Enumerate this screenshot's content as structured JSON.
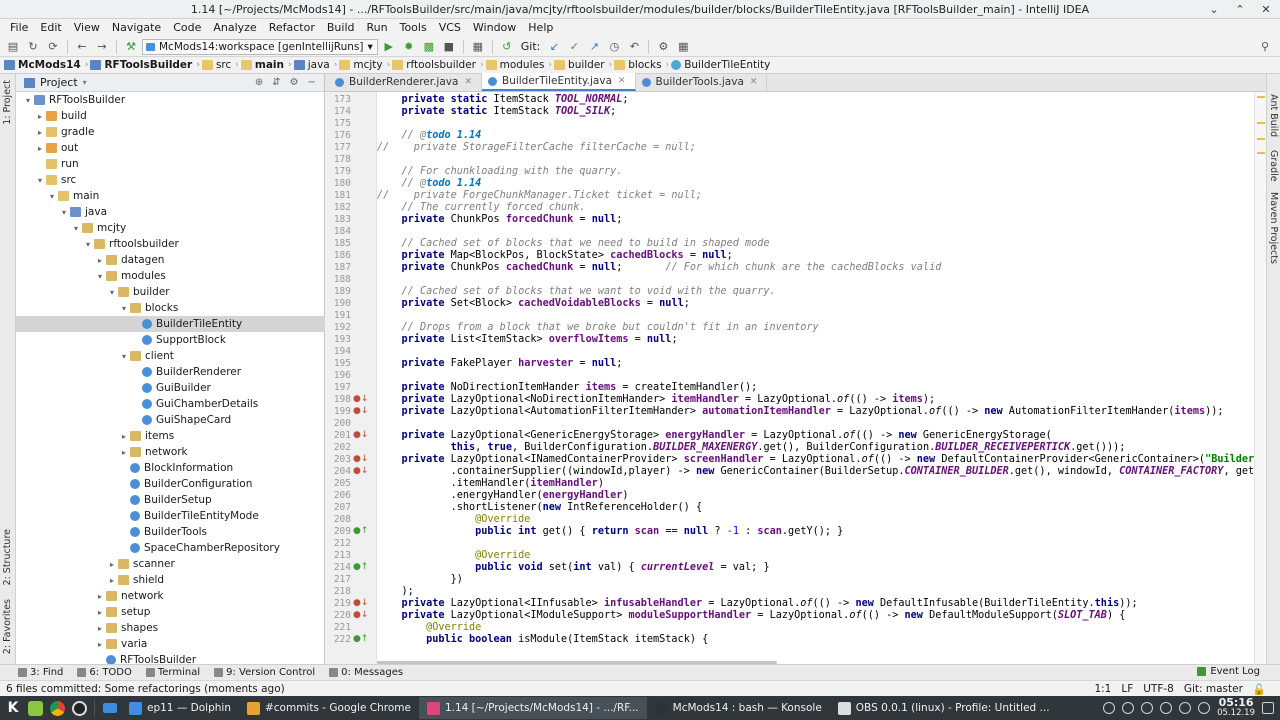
{
  "window": {
    "title": "1.14 [~/Projects/McMods14] - .../RFToolsBuilder/src/main/java/mcjty/rftoolsbuilder/modules/builder/blocks/BuilderTileEntity.java [RFToolsBuilder_main] - IntelliJ IDEA"
  },
  "menu": [
    "File",
    "Edit",
    "View",
    "Navigate",
    "Code",
    "Analyze",
    "Refactor",
    "Build",
    "Run",
    "Tools",
    "VCS",
    "Window",
    "Help"
  ],
  "toolbar": {
    "run_config": "McMods14:workspace [genIntellijRuns]",
    "git_label": "Git:"
  },
  "breadcrumbs": [
    "McMods14",
    "RFToolsBuilder",
    "src",
    "main",
    "java",
    "mcjty",
    "rftoolsbuilder",
    "modules",
    "builder",
    "blocks",
    "BuilderTileEntity"
  ],
  "side_tabs": {
    "project": "1: Project",
    "structure": "2: Structure",
    "favorites": "2: Favorites",
    "ant": "Ant Build",
    "gradle": "Gradle",
    "maven": "Maven Projects"
  },
  "project": {
    "title": "Project",
    "tree": [
      {
        "label": "RFToolsBuilder",
        "depth": 0,
        "twisty": "open",
        "icon": "foldm"
      },
      {
        "label": "build",
        "depth": 1,
        "twisty": "closed",
        "icon": "foldo"
      },
      {
        "label": "gradle",
        "depth": 1,
        "twisty": "closed",
        "icon": "fold"
      },
      {
        "label": "out",
        "depth": 1,
        "twisty": "closed",
        "icon": "foldo"
      },
      {
        "label": "run",
        "depth": 1,
        "twisty": "",
        "icon": "fold"
      },
      {
        "label": "src",
        "depth": 1,
        "twisty": "open",
        "icon": "fold"
      },
      {
        "label": "main",
        "depth": 2,
        "twisty": "open",
        "icon": "fold"
      },
      {
        "label": "java",
        "depth": 3,
        "twisty": "open",
        "icon": "foldm"
      },
      {
        "label": "mcjty",
        "depth": 4,
        "twisty": "open",
        "icon": "pkg"
      },
      {
        "label": "rftoolsbuilder",
        "depth": 5,
        "twisty": "open",
        "icon": "pkg"
      },
      {
        "label": "datagen",
        "depth": 6,
        "twisty": "closed",
        "icon": "pkg"
      },
      {
        "label": "modules",
        "depth": 6,
        "twisty": "open",
        "icon": "pkg"
      },
      {
        "label": "builder",
        "depth": 7,
        "twisty": "open",
        "icon": "pkg"
      },
      {
        "label": "blocks",
        "depth": 8,
        "twisty": "open",
        "icon": "pkg"
      },
      {
        "label": "BuilderTileEntity",
        "depth": 9,
        "twisty": "",
        "icon": "cls",
        "selected": true
      },
      {
        "label": "SupportBlock",
        "depth": 9,
        "twisty": "",
        "icon": "cls"
      },
      {
        "label": "client",
        "depth": 8,
        "twisty": "open",
        "icon": "pkg"
      },
      {
        "label": "BuilderRenderer",
        "depth": 9,
        "twisty": "",
        "icon": "cls"
      },
      {
        "label": "GuiBuilder",
        "depth": 9,
        "twisty": "",
        "icon": "cls"
      },
      {
        "label": "GuiChamberDetails",
        "depth": 9,
        "twisty": "",
        "icon": "cls"
      },
      {
        "label": "GuiShapeCard",
        "depth": 9,
        "twisty": "",
        "icon": "cls"
      },
      {
        "label": "items",
        "depth": 8,
        "twisty": "closed",
        "icon": "pkg"
      },
      {
        "label": "network",
        "depth": 8,
        "twisty": "closed",
        "icon": "pkg"
      },
      {
        "label": "BlockInformation",
        "depth": 8,
        "twisty": "",
        "icon": "cls"
      },
      {
        "label": "BuilderConfiguration",
        "depth": 8,
        "twisty": "",
        "icon": "cls"
      },
      {
        "label": "BuilderSetup",
        "depth": 8,
        "twisty": "",
        "icon": "cls"
      },
      {
        "label": "BuilderTileEntityMode",
        "depth": 8,
        "twisty": "",
        "icon": "cls"
      },
      {
        "label": "BuilderTools",
        "depth": 8,
        "twisty": "",
        "icon": "cls"
      },
      {
        "label": "SpaceChamberRepository",
        "depth": 8,
        "twisty": "",
        "icon": "cls"
      },
      {
        "label": "scanner",
        "depth": 7,
        "twisty": "closed",
        "icon": "pkg"
      },
      {
        "label": "shield",
        "depth": 7,
        "twisty": "closed",
        "icon": "pkg"
      },
      {
        "label": "network",
        "depth": 6,
        "twisty": "closed",
        "icon": "pkg"
      },
      {
        "label": "setup",
        "depth": 6,
        "twisty": "closed",
        "icon": "pkg"
      },
      {
        "label": "shapes",
        "depth": 6,
        "twisty": "closed",
        "icon": "pkg"
      },
      {
        "label": "varia",
        "depth": 6,
        "twisty": "closed",
        "icon": "pkg"
      },
      {
        "label": "RFToolsBuilder",
        "depth": 6,
        "twisty": "",
        "icon": "cls"
      }
    ]
  },
  "tabs": [
    {
      "label": "BuilderRenderer.java",
      "active": false
    },
    {
      "label": "BuilderTileEntity.java",
      "active": true
    },
    {
      "label": "BuilderTools.java",
      "active": false
    }
  ],
  "code": [
    {
      "n": "173",
      "m": "",
      "h": "    <span class='k'>private static</span> ItemStack <span class='fi'>TOOL_NORMAL</span>;"
    },
    {
      "n": "174",
      "m": "",
      "h": "    <span class='k'>private static</span> ItemStack <span class='fi'>TOOL_SILK</span>;"
    },
    {
      "n": "175",
      "m": "",
      "h": ""
    },
    {
      "n": "176",
      "m": "",
      "h": "    <span class='c'>// @</span><span class='t'>todo 1.14</span>"
    },
    {
      "n": "177",
      "m": "",
      "h": "<span class='c'>//    private StorageFilterCache filterCache = null;</span>"
    },
    {
      "n": "178",
      "m": "",
      "h": ""
    },
    {
      "n": "179",
      "m": "",
      "h": "    <span class='c'>// For chunkloading with the quarry.</span>"
    },
    {
      "n": "180",
      "m": "",
      "h": "    <span class='c'>// @</span><span class='t'>todo 1.14</span>"
    },
    {
      "n": "181",
      "m": "",
      "h": "<span class='c'>//    private ForgeChunkManager.Ticket ticket = null;</span>"
    },
    {
      "n": "182",
      "m": "",
      "h": "    <span class='c'>// The currently forced chunk.</span>"
    },
    {
      "n": "183",
      "m": "",
      "h": "    <span class='k'>private</span> ChunkPos <span class='f'>forcedChunk</span> = <span class='k'>null</span>;"
    },
    {
      "n": "184",
      "m": "",
      "h": ""
    },
    {
      "n": "185",
      "m": "",
      "h": "    <span class='c'>// Cached set of blocks that we need to build in shaped mode</span>"
    },
    {
      "n": "186",
      "m": "",
      "h": "    <span class='k'>private</span> Map&lt;BlockPos, BlockState&gt; <span class='f'>cachedBlocks</span> = <span class='k'>null</span>;"
    },
    {
      "n": "187",
      "m": "",
      "h": "    <span class='k'>private</span> ChunkPos <span class='f'>cachedChunk</span> = <span class='k'>null</span>;       <span class='c'>// For which chunk are the cachedBlocks valid</span>"
    },
    {
      "n": "188",
      "m": "",
      "h": ""
    },
    {
      "n": "189",
      "m": "",
      "h": "    <span class='c'>// Cached set of blocks that we want to void with the quarry.</span>"
    },
    {
      "n": "190",
      "m": "",
      "h": "    <span class='k'>private</span> Set&lt;Block&gt; <span class='f'>cachedVoidableBlocks</span> = <span class='k'>null</span>;"
    },
    {
      "n": "191",
      "m": "",
      "h": ""
    },
    {
      "n": "192",
      "m": "",
      "h": "    <span class='c'>// Drops from a block that we broke but couldn't fit in an inventory</span>"
    },
    {
      "n": "193",
      "m": "",
      "h": "    <span class='k'>private</span> List&lt;ItemStack&gt; <span class='f'>overflowItems</span> = <span class='k'>null</span>;"
    },
    {
      "n": "194",
      "m": "",
      "h": ""
    },
    {
      "n": "195",
      "m": "",
      "h": "    <span class='k'>private</span> FakePlayer <span class='f'>harvester</span> = <span class='k'>null</span>;"
    },
    {
      "n": "196",
      "m": "",
      "h": ""
    },
    {
      "n": "197",
      "m": "",
      "h": "    <span class='k'>private</span> NoDirectionItemHander <span class='f'>items</span> = createItemHandler();"
    },
    {
      "n": "198",
      "m": "gm",
      "h": "    <span class='k'>private</span> LazyOptional&lt;NoDirectionItemHander&gt; <span class='f'>itemHandler</span> = LazyOptional.<span class='it'>of</span>(() -&gt; <span class='f'>items</span>);"
    },
    {
      "n": "199",
      "m": "gm",
      "h": "    <span class='k'>private</span> LazyOptional&lt;AutomationFilterItemHander&gt; <span class='f'>automationItemHandler</span> = LazyOptional.<span class='it'>of</span>(() -&gt; <span class='k'>new</span> AutomationFilterItemHander(<span class='f'>items</span>));"
    },
    {
      "n": "200",
      "m": "",
      "h": ""
    },
    {
      "n": "201",
      "m": "gm",
      "h": "    <span class='k'>private</span> LazyOptional&lt;GenericEnergyStorage&gt; <span class='f'>energyHandler</span> = LazyOptional.<span class='it'>of</span>(() -&gt; <span class='k'>new</span> GenericEnergyStorage("
    },
    {
      "n": "202",
      "m": "",
      "h": "            <span class='k'>this</span>, <span class='k'>true</span>, BuilderConfiguration.<span class='fi'>BUILDER_MAXENERGY</span>.get(), BuilderConfiguration.<span class='fi'>BUILDER_RECEIVEPERTICK</span>.get()));"
    },
    {
      "n": "203",
      "m": "gm",
      "h": "    <span class='k'>private</span> LazyOptional&lt;INamedContainerProvider&gt; <span class='f'>screenHandler</span> = LazyOptional.<span class='it'>of</span>(() -&gt; <span class='k'>new</span> DefaultContainerProvider&lt;GenericContainer&gt;(<span class='s'>\"Builder\"</span>)"
    },
    {
      "n": "204",
      "m": "gm",
      "h": "            .containerSupplier((windowId,player) -&gt; <span class='k'>new</span> GenericContainer(BuilderSetup.<span class='fi'>CONTAINER_BUILDER</span>.get(), windowId, <span class='fi'>CONTAINER_FACTORY</span>, getPos"
    },
    {
      "n": "205",
      "m": "",
      "h": "            .itemHandler(<span class='f'>itemHandler</span>)"
    },
    {
      "n": "206",
      "m": "",
      "h": "            .energyHandler(<span class='f'>energyHandler</span>)"
    },
    {
      "n": "207",
      "m": "",
      "h": "            .shortListener(<span class='k'>new</span> IntReferenceHolder() {"
    },
    {
      "n": "208",
      "m": "",
      "h": "                <span class='a'>@Override</span>"
    },
    {
      "n": "209",
      "m": "go",
      "h": "                <span class='k'>public int</span> get() { <span class='k'>return</span> <span class='f'>scan</span> == <span class='k'>null</span> ? <span class='n'>-1</span> : <span class='f'>scan</span>.getY(); }"
    },
    {
      "n": "212",
      "m": "",
      "h": ""
    },
    {
      "n": "213",
      "m": "",
      "h": "                <span class='a'>@Override</span>"
    },
    {
      "n": "214",
      "m": "go",
      "h": "                <span class='k'>public void</span> set(<span class='k'>int</span> val) { <span class='fi'>currentLevel</span> = val; }"
    },
    {
      "n": "217",
      "m": "",
      "h": "            })"
    },
    {
      "n": "218",
      "m": "",
      "h": "    );"
    },
    {
      "n": "219",
      "m": "gm",
      "h": "    <span class='k'>private</span> LazyOptional&lt;IInfusable&gt; <span class='f'>infusableHandler</span> = LazyOptional.<span class='it'>of</span>(() -&gt; <span class='k'>new</span> DefaultInfusable(BuilderTileEntity.<span class='k'>this</span>));"
    },
    {
      "n": "220",
      "m": "gm",
      "h": "    <span class='k'>private</span> LazyOptional&lt;IModuleSupport&gt; <span class='f'>moduleSupportHandler</span> = LazyOptional.<span class='it'>of</span>(() -&gt; <span class='k'>new</span> DefaultModuleSupport(<span class='fi'>SLOT_TAB</span>) {"
    },
    {
      "n": "221",
      "m": "",
      "h": "        <span class='a'>@Override</span>"
    },
    {
      "n": "222",
      "m": "go",
      "h": "        <span class='k'>public boolean</span> isModule(ItemStack itemStack) {"
    }
  ],
  "tool_windows": [
    {
      "label": "3: Find"
    },
    {
      "label": "6: TODO"
    },
    {
      "label": "Terminal"
    },
    {
      "label": "9: Version Control"
    },
    {
      "label": "0: Messages"
    }
  ],
  "event_log": "Event Log",
  "status": {
    "message": "6 files committed: Some refactorings (moments ago)",
    "position": "1:1",
    "line_sep": "LF",
    "encoding": "UTF-8",
    "vcs": "Git: master"
  },
  "taskbar": {
    "tasks": [
      {
        "label": "ep11 — Dolphin",
        "color": "#3d8ee0"
      },
      {
        "label": "#commits - Google Chrome",
        "color": "#e8a231"
      },
      {
        "label": "1.14 [~/Projects/McMods14] - .../RF...",
        "color": "#e0457a",
        "active": true
      },
      {
        "label": "McMods14 : bash — Konsole",
        "color": "#2e3338"
      },
      {
        "label": "OBS 0.0.1 (linux) - Profile: Untitled ...",
        "color": "#dddddd"
      }
    ],
    "clock": {
      "time": "05:16",
      "date": "05.12.19"
    }
  }
}
